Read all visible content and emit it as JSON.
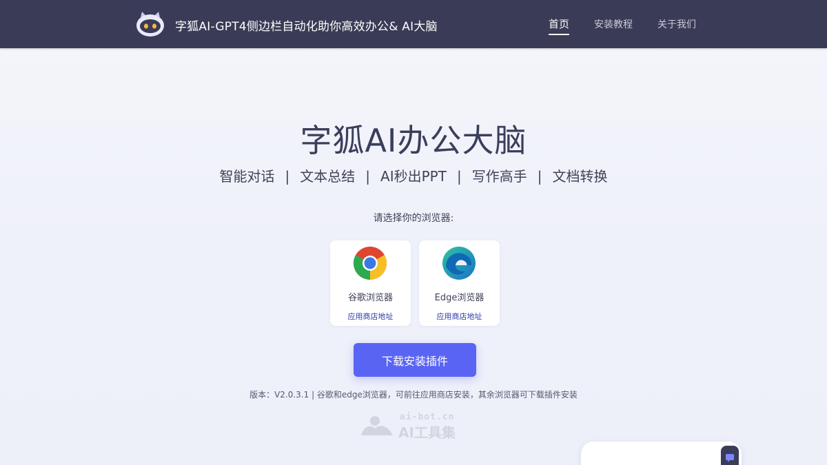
{
  "header": {
    "site_title": "字狐AI-GPT4侧边栏自动化助你高效办公& AI大脑",
    "nav": [
      {
        "label": "首页",
        "active": true
      },
      {
        "label": "安装教程",
        "active": false
      },
      {
        "label": "关于我们",
        "active": false
      }
    ]
  },
  "hero": {
    "title": "字狐AI办公大脑",
    "features": [
      "智能对话",
      "文本总结",
      "AI秒出PPT",
      "写作高手",
      "文档转换"
    ],
    "separator": "|"
  },
  "browser_select": {
    "prompt": "请选择你的浏览器:",
    "browsers": [
      {
        "name": "谷歌浏览器",
        "link": "应用商店地址",
        "icon": "chrome-icon"
      },
      {
        "name": "Edge浏览器",
        "link": "应用商店地址",
        "icon": "edge-icon"
      }
    ]
  },
  "download": {
    "label": "下载安装插件"
  },
  "version_note": "版本：V2.0.3.1 | 谷歌和edge浏览器，可前往应用商店安装，其余浏览器可下载插件安装",
  "watermark": {
    "url": "ai-bot.cn",
    "name": "AI工具集"
  },
  "colors": {
    "header_bg": "#3a3b56",
    "accent": "#5a64f4",
    "link": "#2b38a8"
  }
}
